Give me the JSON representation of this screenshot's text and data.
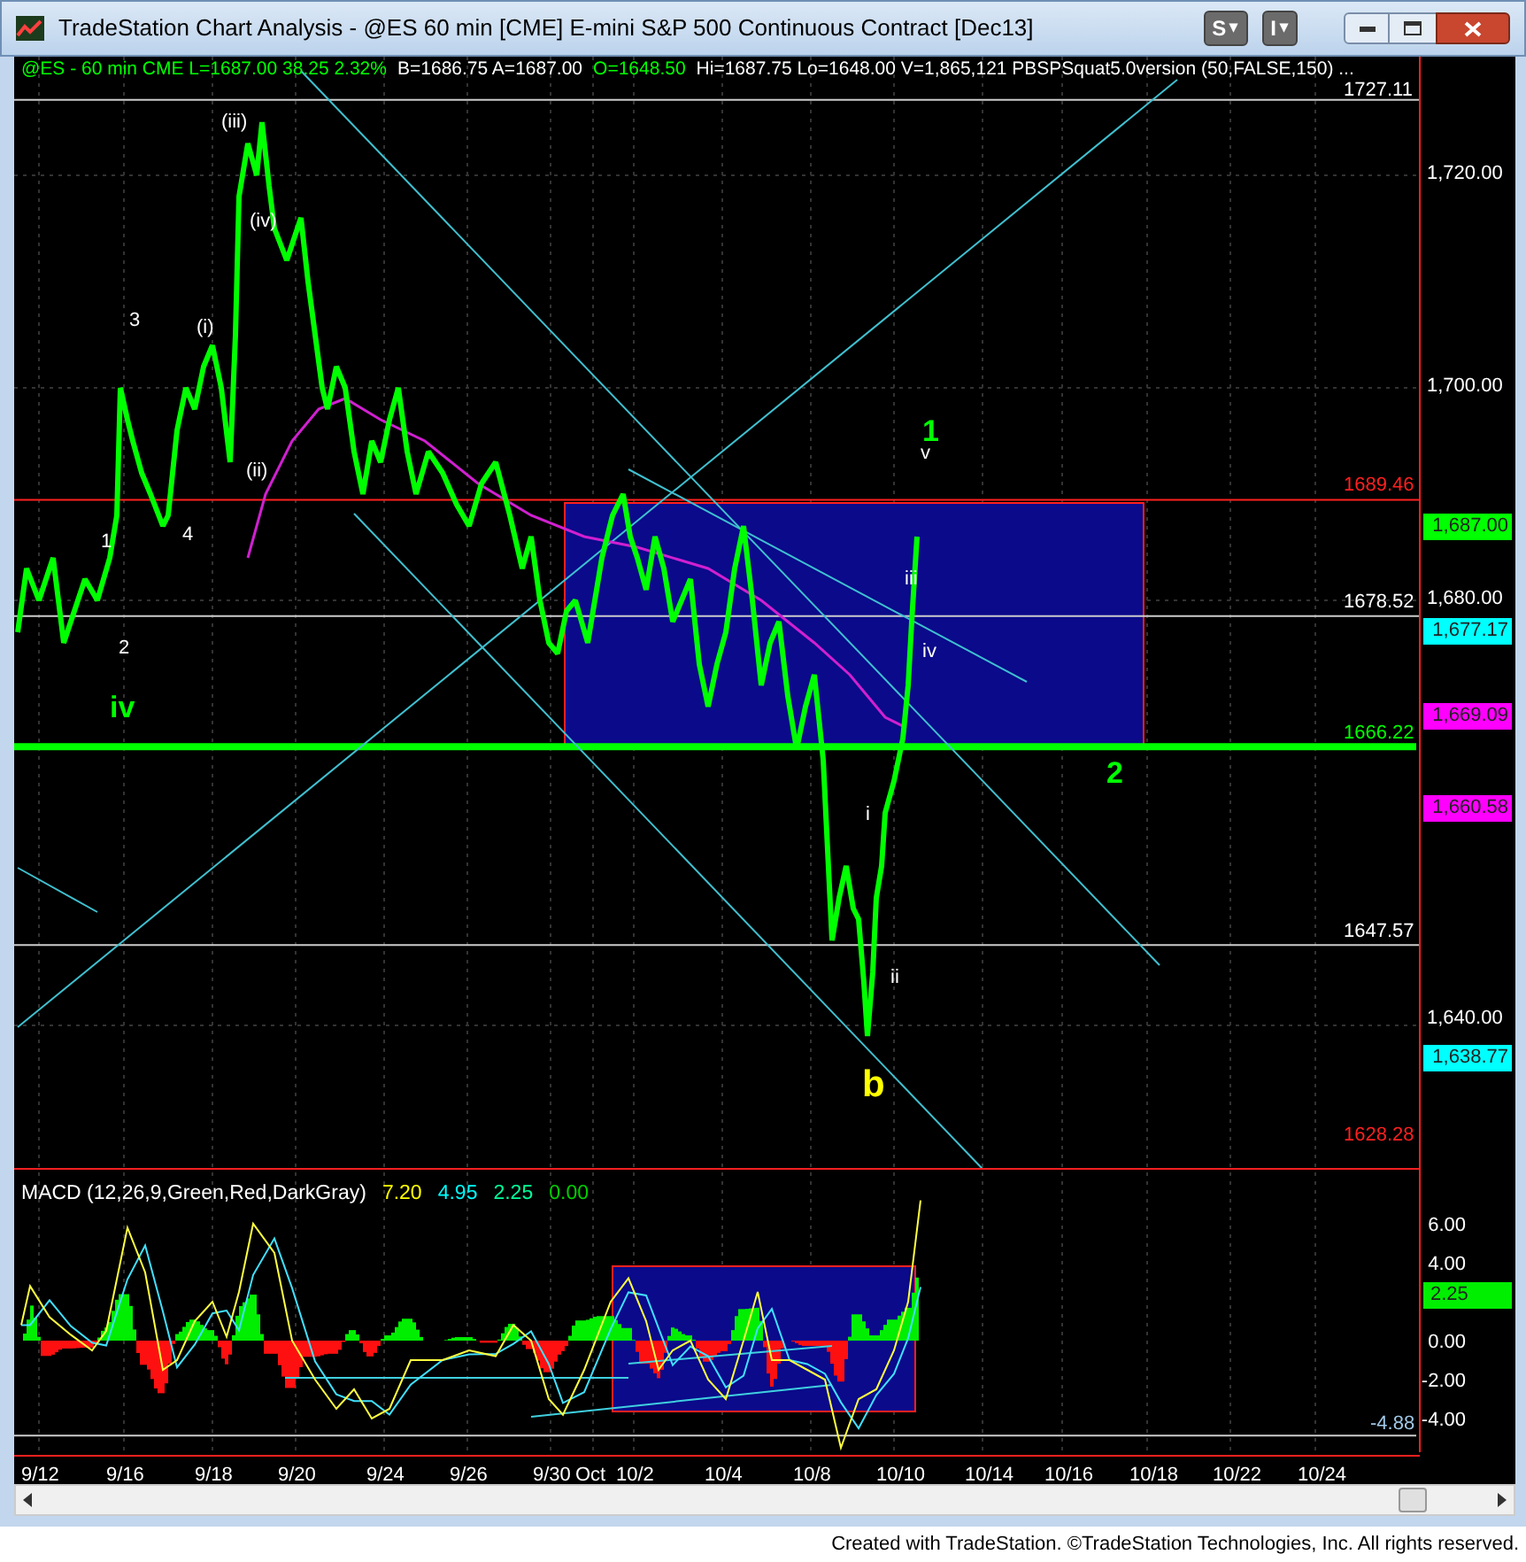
{
  "window": {
    "title": "TradeStation Chart Analysis - @ES 60 min [CME] E-mini S&P 500 Continuous Contract [Dec13]",
    "buttons": [
      {
        "label": "S",
        "caret": "▾"
      },
      {
        "label": "I",
        "caret": "▾"
      }
    ]
  },
  "info_bar": [
    {
      "text": "@ES - 60 min  CME  L=1687.00  38.25  2.32%",
      "color": "#00ff00"
    },
    {
      "text": "B=1686.75  A=1687.00",
      "color": "#ffffff"
    },
    {
      "text": "O=1648.50",
      "color": "#00ff00"
    },
    {
      "text": "Hi=1687.75  Lo=1648.00  V=1,865,121  PBSPSquat5.0version (50,FALSE,150) ...",
      "color": "#ffffff"
    }
  ],
  "price_axis": [
    "1,720.00",
    "1,700.00",
    "1,680.00",
    "1,640.00"
  ],
  "price_levels": [
    {
      "text": "1727.11",
      "color": "#ffffff"
    },
    {
      "text": "1689.46",
      "color": "#ff2020"
    },
    {
      "text": "1678.52",
      "color": "#ffffff"
    },
    {
      "text": "1666.22",
      "color": "#00ff00"
    },
    {
      "text": "1647.57",
      "color": "#ffffff"
    },
    {
      "text": "1628.28",
      "color": "#ff2020"
    }
  ],
  "price_badges": [
    {
      "text": "1,687.00",
      "color": "#00ff00"
    },
    {
      "text": "1,677.17",
      "color": "#00ffff"
    },
    {
      "text": "1,669.09",
      "color": "#ff00ff"
    },
    {
      "text": "1,660.58",
      "color": "#ff00ff"
    },
    {
      "text": "1,638.77",
      "color": "#00ffff"
    }
  ],
  "wave_labels": [
    {
      "text": "(iii)",
      "color": "#ffffff"
    },
    {
      "text": "(iv)",
      "color": "#ffffff"
    },
    {
      "text": "3",
      "color": "#ffffff"
    },
    {
      "text": "(i)",
      "color": "#ffffff"
    },
    {
      "text": "(ii)",
      "color": "#ffffff"
    },
    {
      "text": "4",
      "color": "#ffffff"
    },
    {
      "text": "1",
      "color": "#ffffff"
    },
    {
      "text": "2",
      "color": "#ffffff"
    },
    {
      "text": "iv",
      "color": "#00ff00"
    },
    {
      "text": "1",
      "color": "#00ff00"
    },
    {
      "text": "v",
      "color": "#ffffff"
    },
    {
      "text": "iii",
      "color": "#ffffff"
    },
    {
      "text": "iv",
      "color": "#ffffff"
    },
    {
      "text": "i",
      "color": "#ffffff"
    },
    {
      "text": "ii",
      "color": "#ffffff"
    },
    {
      "text": "b",
      "color": "#ffff00"
    },
    {
      "text": "2",
      "color": "#00ff00"
    }
  ],
  "macd": {
    "title": "MACD (12,26,9,Green,Red,DarkGray)",
    "values": [
      {
        "text": "7.20",
        "color": "#ffff00"
      },
      {
        "text": "4.95",
        "color": "#00ffff"
      },
      {
        "text": "2.25",
        "color": "#00ff99"
      },
      {
        "text": "0.00",
        "color": "#00cc00"
      }
    ],
    "axis": [
      "6.00",
      "4.00",
      "0.00",
      "-2.00",
      "-4.00"
    ],
    "badge": "2.25",
    "level_label": "-4.88"
  },
  "date_axis": [
    "9/12",
    "9/16",
    "9/18",
    "9/20",
    "9/24",
    "9/26",
    "9/30",
    "Oct",
    "10/2",
    "10/4",
    "10/8",
    "10/10",
    "10/14",
    "10/16",
    "10/18",
    "10/22",
    "10/24"
  ],
  "footer": "Created with TradeStation. ©TradeStation Technologies, Inc. All rights reserved."
}
